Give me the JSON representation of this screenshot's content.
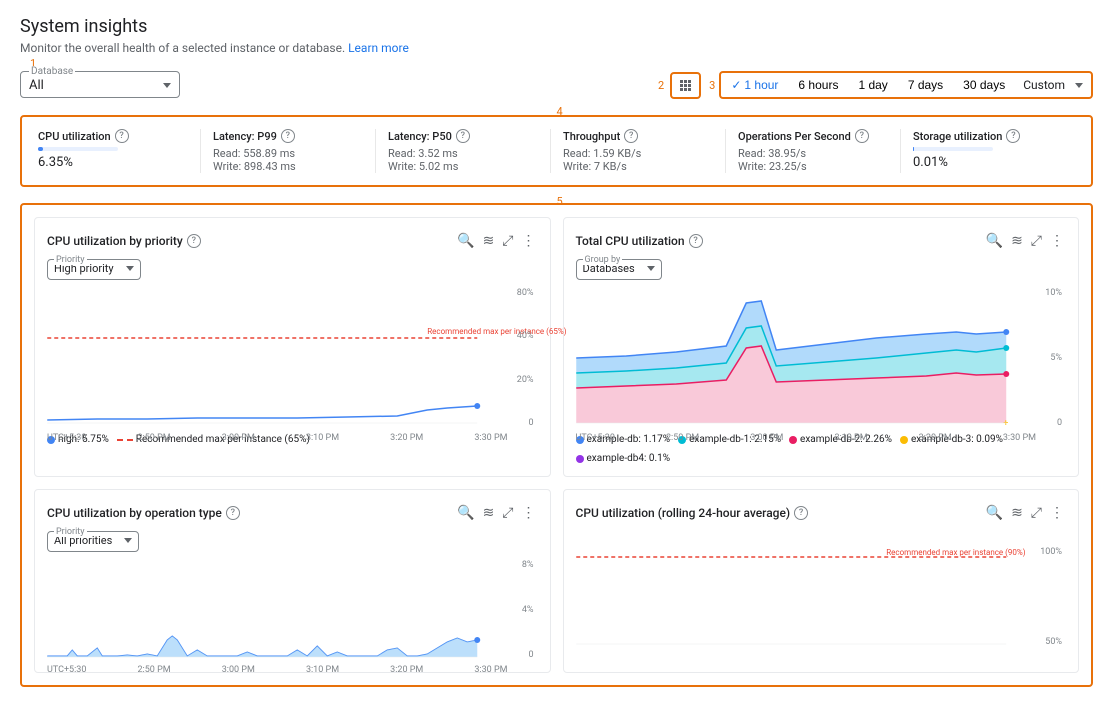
{
  "page": {
    "title": "System insights",
    "description": "Monitor the overall health of a selected instance or database.",
    "learn_more": "Learn more"
  },
  "labels": {
    "num1": "1",
    "num2": "2",
    "num3": "3",
    "num4": "4",
    "num5": "5"
  },
  "database_select": {
    "label": "Database",
    "value": "All"
  },
  "time_range": {
    "options": [
      "1 hour",
      "6 hours",
      "1 day",
      "7 days",
      "30 days",
      "Custom"
    ],
    "active": "1 hour"
  },
  "metrics": [
    {
      "title": "CPU utilization",
      "value": "6.35%",
      "bar_pct": 6
    },
    {
      "title": "Latency: P99",
      "sub1": "Read: 558.89 ms",
      "sub2": "Write: 898.43 ms"
    },
    {
      "title": "Latency: P50",
      "sub1": "Read: 3.52 ms",
      "sub2": "Write: 5.02 ms"
    },
    {
      "title": "Throughput",
      "sub1": "Read: 1.59 KB/s",
      "sub2": "Write: 7 KB/s"
    },
    {
      "title": "Operations Per Second",
      "sub1": "Read: 38.95/s",
      "sub2": "Write: 23.25/s"
    },
    {
      "title": "Storage utilization",
      "value": "0.01%",
      "bar_pct": 1
    }
  ],
  "charts": [
    {
      "id": "cpu-priority",
      "title": "CPU utilization by priority",
      "priority_label": "Priority",
      "priority_value": "High priority",
      "y_labels": [
        "80%",
        "40%",
        "20%",
        "0"
      ],
      "x_labels": [
        "UTC+5:30",
        "2:50 PM",
        "3:00 PM",
        "3:10 PM",
        "3:20 PM",
        "3:30 PM"
      ],
      "legend": [
        {
          "type": "dot",
          "color": "#4285f4",
          "label": "high: 5.75%"
        },
        {
          "type": "dashed",
          "color": "#ea4335",
          "label": "Recommended max per instance (65%)"
        }
      ]
    },
    {
      "id": "total-cpu",
      "title": "Total CPU utilization",
      "group_label": "Group by",
      "group_value": "Databases",
      "y_labels": [
        "10%",
        "5%",
        "0"
      ],
      "x_labels": [
        "UTC+5:30",
        "2:50 PM",
        "3:00 PM",
        "3:10 PM",
        "3:20 PM",
        "3:30 PM"
      ],
      "legend": [
        {
          "type": "dot",
          "color": "#4285f4",
          "label": "example-db: 1.17%"
        },
        {
          "type": "dot",
          "color": "#34a853",
          "label": "example-db-1: 2.15%"
        },
        {
          "type": "dot",
          "color": "#ea4335",
          "label": "example-db-2: 2.26%"
        },
        {
          "type": "dot",
          "color": "#fbbc04",
          "label": "example-db-3: 0.09%"
        },
        {
          "type": "dot",
          "color": "#9334e6",
          "label": "example-db4: 0.1%"
        }
      ]
    },
    {
      "id": "cpu-operation",
      "title": "CPU utilization by operation type",
      "priority_label": "Priority",
      "priority_value": "All priorities",
      "y_labels": [
        "8%",
        "4%",
        "0"
      ],
      "x_labels": [
        "UTC+5:30",
        "2:50 PM",
        "3:00 PM",
        "3:10 PM",
        "3:20 PM",
        "3:30 PM"
      ]
    },
    {
      "id": "cpu-rolling",
      "title": "CPU utilization (rolling 24-hour average)",
      "y_labels": [
        "100%",
        "50%"
      ],
      "x_labels": []
    }
  ]
}
